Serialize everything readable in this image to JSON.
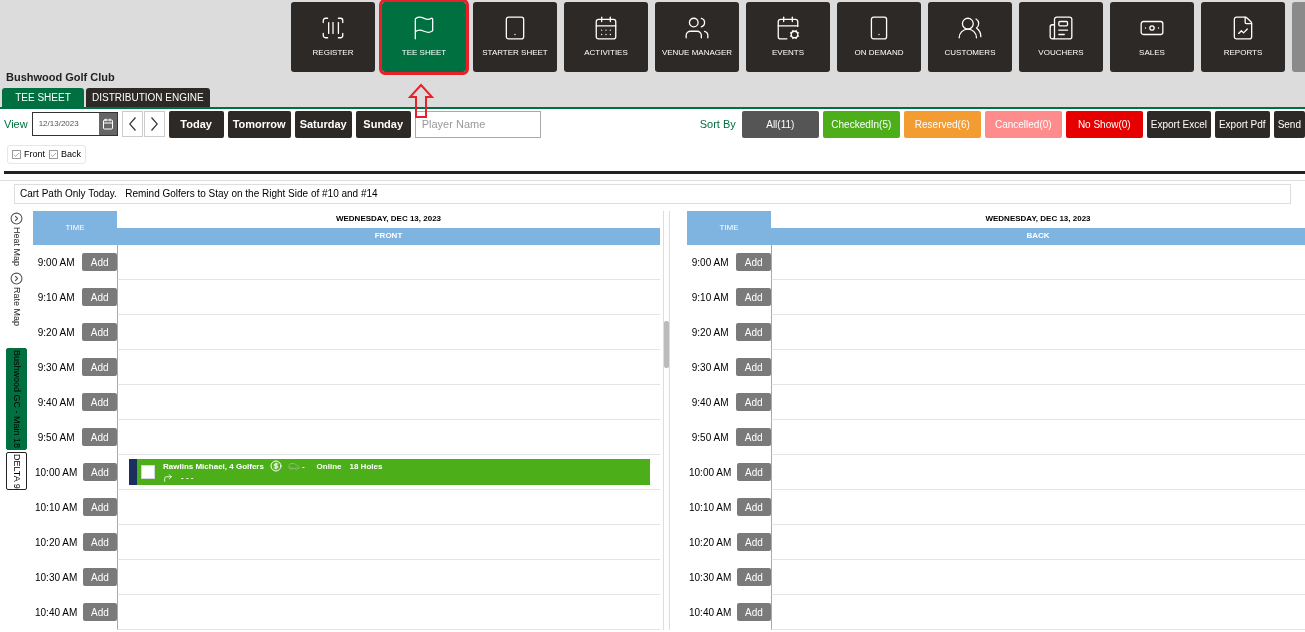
{
  "nav": [
    {
      "label": "REGISTER",
      "selected": false
    },
    {
      "label": "TEE SHEET",
      "selected": true
    },
    {
      "label": "STARTER SHEET",
      "selected": false
    },
    {
      "label": "ACTIVITIES",
      "selected": false
    },
    {
      "label": "VENUE MANAGER",
      "selected": false
    },
    {
      "label": "EVENTS",
      "selected": false
    },
    {
      "label": "ON DEMAND",
      "selected": false
    },
    {
      "label": "CUSTOMERS",
      "selected": false
    },
    {
      "label": "VOUCHERS",
      "selected": false
    },
    {
      "label": "SALES",
      "selected": false
    },
    {
      "label": "REPORTS",
      "selected": false
    }
  ],
  "club": "Bushwood Golf Club",
  "tabs": [
    {
      "label": "TEE SHEET",
      "selected": true
    },
    {
      "label": "DISTRIBUTION ENGINE",
      "selected": false
    }
  ],
  "toolbar": {
    "view_label": "View",
    "date": "12/13/2023",
    "quick_days": [
      "Today",
      "Tomorrow",
      "Saturday",
      "Sunday"
    ],
    "search": {
      "placeholder": "Player Name"
    },
    "sort_label": "Sort By",
    "filters": [
      {
        "label": "All(11)",
        "color": "#555555"
      },
      {
        "label": "CheckedIn(5)",
        "color": "#4caf19"
      },
      {
        "label": "Reserved(6)",
        "color": "#f39c32"
      },
      {
        "label": "Cancelled(0)",
        "color": "#ff8c8c"
      },
      {
        "label": "No Show(0)",
        "color": "#e60000"
      }
    ],
    "actions": [
      "Export Excel",
      "Export Pdf",
      "Send"
    ]
  },
  "sides": [
    {
      "label": "Front",
      "checked": true
    },
    {
      "label": "Back",
      "checked": true
    }
  ],
  "notice": "Cart Path Only Today.   Remind Golfers to Stay on the Right Side of #10 and #14",
  "side_tabs": [
    {
      "label": "Heat Map",
      "kind": "toggle",
      "selected": false
    },
    {
      "label": "Rate Map",
      "kind": "toggle",
      "selected": false
    },
    {
      "label": "Bushwood GC - Main 18",
      "kind": "course",
      "selected": true
    },
    {
      "label": "DELTA 9",
      "kind": "course",
      "selected": false
    }
  ],
  "panels": [
    {
      "time_heading": "TIME",
      "date": "WEDNESDAY, DEC 13, 2023",
      "side": "FRONT",
      "rows": [
        {
          "time": "9:00 AM",
          "add": "Add"
        },
        {
          "time": "9:10 AM",
          "add": "Add"
        },
        {
          "time": "9:20 AM",
          "add": "Add"
        },
        {
          "time": "9:30 AM",
          "add": "Add"
        },
        {
          "time": "9:40 AM",
          "add": "Add"
        },
        {
          "time": "9:50 AM",
          "add": "Add"
        },
        {
          "time": "10:00 AM",
          "add": "Add",
          "booking": {
            "name": "Rawlins Michael, 4 Golfers",
            "cart": "-",
            "source": "Online",
            "holes": "18 Holes",
            "notes": "- - -",
            "color": "#4caf19",
            "checked": false
          }
        },
        {
          "time": "10:10 AM",
          "add": "Add"
        },
        {
          "time": "10:20 AM",
          "add": "Add"
        },
        {
          "time": "10:30 AM",
          "add": "Add"
        },
        {
          "time": "10:40 AM",
          "add": "Add"
        }
      ]
    },
    {
      "time_heading": "TIME",
      "date": "WEDNESDAY, DEC 13, 2023",
      "side": "BACK",
      "rows": [
        {
          "time": "9:00 AM",
          "add": "Add"
        },
        {
          "time": "9:10 AM",
          "add": "Add"
        },
        {
          "time": "9:20 AM",
          "add": "Add"
        },
        {
          "time": "9:30 AM",
          "add": "Add"
        },
        {
          "time": "9:40 AM",
          "add": "Add"
        },
        {
          "time": "9:50 AM",
          "add": "Add"
        },
        {
          "time": "10:00 AM",
          "add": "Add"
        },
        {
          "time": "10:10 AM",
          "add": "Add"
        },
        {
          "time": "10:20 AM",
          "add": "Add"
        },
        {
          "time": "10:30 AM",
          "add": "Add"
        },
        {
          "time": "10:40 AM",
          "add": "Add"
        }
      ]
    }
  ]
}
